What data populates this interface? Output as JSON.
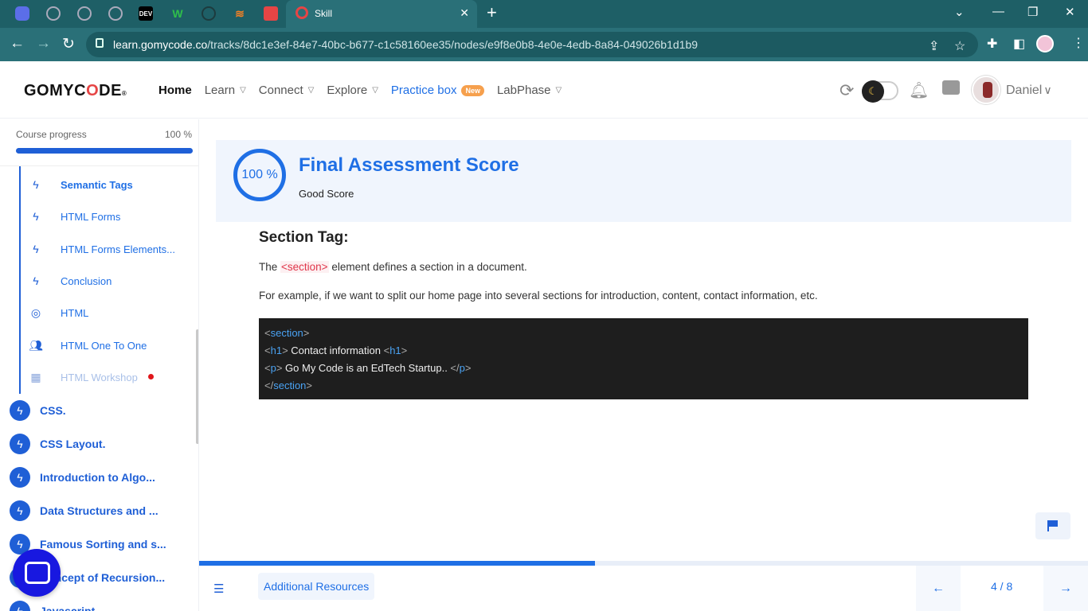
{
  "browser": {
    "tabs": [
      {
        "icon": "app-icon"
      },
      {
        "icon": "globe-icon"
      },
      {
        "icon": "globe-icon"
      },
      {
        "icon": "globe-icon"
      },
      {
        "icon": "dev-icon",
        "label": "DEV"
      },
      {
        "icon": "w-icon",
        "label": "W"
      },
      {
        "icon": "github-icon"
      },
      {
        "icon": "stackoverflow-icon"
      },
      {
        "icon": "gomycode-icon"
      }
    ],
    "active_tab_title": "Skill",
    "url_domain": "learn.gomycode.co",
    "url_path": "/tracks/8dc1e3ef-84e7-40bc-b677-c1c58160ee35/nodes/e9f8e0b8-4e0e-4edb-8a84-049026b1d1b9"
  },
  "header": {
    "logo_prefix": "GOMYC",
    "logo_o": "O",
    "logo_suffix": "DE",
    "logo_reg": "®",
    "nav": [
      {
        "label": "Home"
      },
      {
        "label": "Learn"
      },
      {
        "label": "Connect"
      },
      {
        "label": "Explore"
      },
      {
        "label": "Practice box",
        "badge": "New"
      },
      {
        "label": "LabPhase"
      }
    ],
    "user_name": "Daniel"
  },
  "sidebar": {
    "progress_label": "Course progress",
    "progress_value": "100 %",
    "progress_fraction": 1.0,
    "sub_items": [
      {
        "label": "Semantic Tags",
        "icon": "bolt-icon"
      },
      {
        "label": "HTML Forms",
        "icon": "bolt-icon"
      },
      {
        "label": "HTML Forms Elements...",
        "icon": "bolt-icon"
      },
      {
        "label": "Conclusion",
        "icon": "bolt-icon"
      },
      {
        "label": "HTML",
        "icon": "target-icon"
      },
      {
        "label": "HTML One To One",
        "icon": "people-icon"
      },
      {
        "label": "HTML Workshop",
        "icon": "workshop-icon"
      }
    ],
    "modules": [
      {
        "label": "CSS."
      },
      {
        "label": "CSS Layout."
      },
      {
        "label": "Introduction to Algo..."
      },
      {
        "label": "Data Structures and ..."
      },
      {
        "label": "Famous Sorting and s..."
      },
      {
        "label": "Concept of Recursion..."
      },
      {
        "label": "Javascript"
      }
    ]
  },
  "score": {
    "value": "100 %",
    "title": "Final Assessment Score",
    "subtitle": "Good Score"
  },
  "lesson": {
    "section_title": "Section Tag:",
    "para1_before": "The ",
    "para1_tag": "<section>",
    "para1_after": " element defines a section in a document.",
    "para2": "For example, if we want to split our home page into several sections for introduction, content, contact information, etc.",
    "code": {
      "l1_open": "<",
      "l1_tag": "section",
      "l1_close": ">",
      "l2_open1": "<",
      "l2_tag1": "h1",
      "l2_close1": ">",
      "l2_text": " Contact information ",
      "l2_open2": "<",
      "l2_tag2": "h1",
      "l2_close2": ">",
      "l3_open1": "<",
      "l3_tag1": "p",
      "l3_close1": ">",
      "l3_text": " Go My Code is an EdTech Startup.. ",
      "l3_open2": "</",
      "l3_tag2": "p",
      "l3_close2": ">",
      "l4_open": "</",
      "l4_tag": "section",
      "l4_close": ">"
    }
  },
  "bottom": {
    "resources_label": "Additional Resources",
    "page_count": "4 / 8",
    "lesson_progress_fraction": 0.445
  },
  "colors": {
    "accent": "#1f6fe5",
    "chrome": "#2a7078",
    "code_bg": "#1e1e1e",
    "badge": "#f6a04d"
  }
}
